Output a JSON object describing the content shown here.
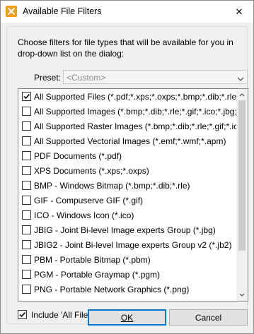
{
  "window": {
    "title": "Available File Filters",
    "close_glyph": "✕",
    "app_icon": "pdf-xchange-icon"
  },
  "description": "Choose filters for file types that will be available for you in\ndrop-down list on the dialog:",
  "preset": {
    "label": "Preset:",
    "value": "<Custom>"
  },
  "filters": [
    {
      "label": "All Supported Files (*.pdf;*.xps;*.oxps;*.bmp;*.dib;*.rle;",
      "checked": true
    },
    {
      "label": "All Supported Images (*.bmp;*.dib;*.rle;*.gif;*.ico;*.jbg;",
      "checked": false
    },
    {
      "label": "All Supported Raster Images (*.bmp;*.dib;*.rle;*.gif;*.ico",
      "checked": false
    },
    {
      "label": "All Supported Vectorial Images (*.emf;*.wmf;*.apm)",
      "checked": false
    },
    {
      "label": "PDF Documents (*.pdf)",
      "checked": false
    },
    {
      "label": "XPS Documents (*.xps;*.oxps)",
      "checked": false
    },
    {
      "label": "BMP - Windows Bitmap (*.bmp;*.dib;*.rle)",
      "checked": false
    },
    {
      "label": "GIF - Compuserve GIF (*.gif)",
      "checked": false
    },
    {
      "label": "ICO - Windows Icon (*.ico)",
      "checked": false
    },
    {
      "label": "JBIG - Joint Bi-level Image experts Group (*.jbg)",
      "checked": false
    },
    {
      "label": "JBIG2 - Joint Bi-level Image experts Group v2 (*.jb2)",
      "checked": false
    },
    {
      "label": "PBM - Portable Bitmap (*.pbm)",
      "checked": false
    },
    {
      "label": "PGM - Portable Graymap (*.pgm)",
      "checked": false
    },
    {
      "label": "PNG - Portable Network Graphics (*.png)",
      "checked": false
    }
  ],
  "include_all": {
    "label": "Include 'All Files (*.*)' filter",
    "checked": true
  },
  "buttons": {
    "ok": "OK",
    "cancel": "Cancel"
  },
  "colors": {
    "accent": "#0078d7",
    "icon_orange": "#f39c12"
  }
}
